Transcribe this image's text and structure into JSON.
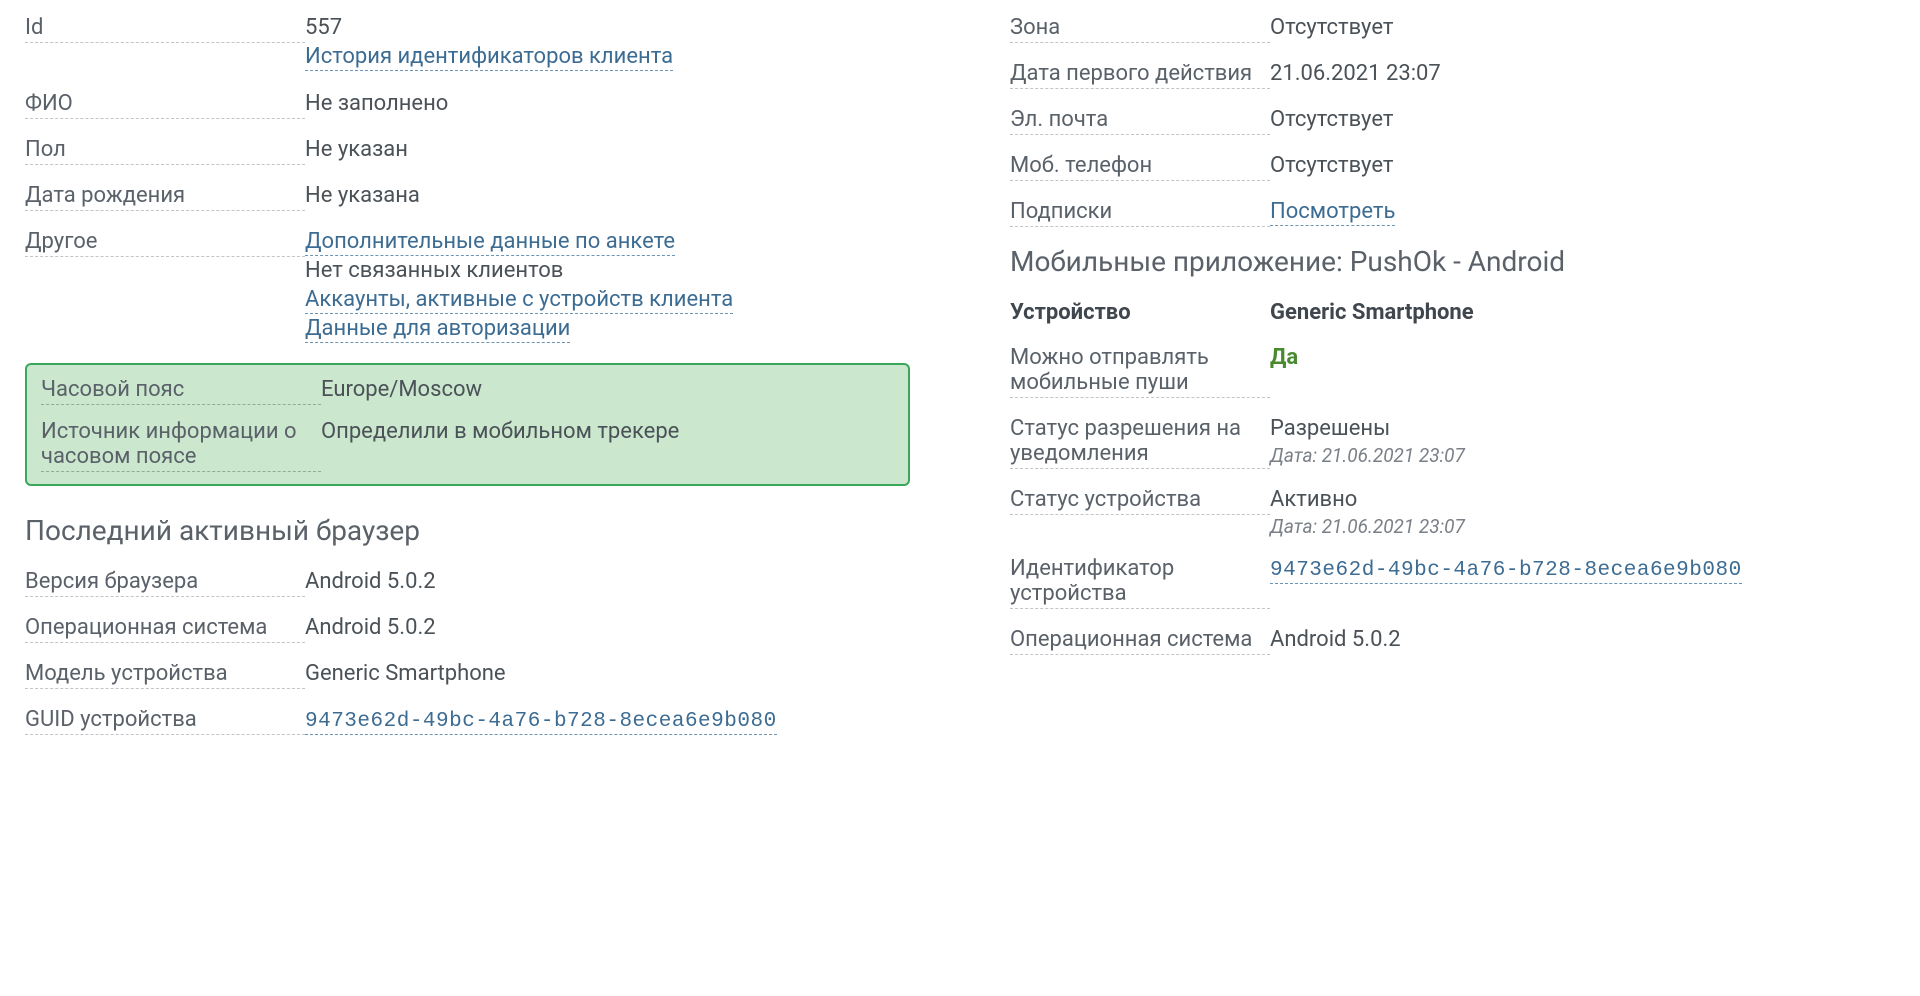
{
  "left": {
    "id_label": "Id",
    "id_value": "557",
    "id_history_link": "История идентификаторов клиента",
    "fio_label": "ФИО",
    "fio_value": "Не заполнено",
    "gender_label": "Пол",
    "gender_value": "Не указан",
    "dob_label": "Дата рождения",
    "dob_value": "Не указана",
    "other_label": "Другое",
    "other_link1": "Дополнительные данные по анкете",
    "other_text": "Нет связанных клиентов",
    "other_link2": "Аккаунты, активные с устройств клиента",
    "other_link3": "Данные для авторизации",
    "tz_label": "Часовой пояс",
    "tz_value": "Europe/Moscow",
    "tz_src_label": "Источник информации о часовом поясе",
    "tz_src_value": "Определили в мобильном трекере",
    "browser_title": "Последний активный браузер",
    "browser_ver_label": "Версия браузера",
    "browser_ver_value": "Android 5.0.2",
    "os_label": "Операционная система",
    "os_value": "Android 5.0.2",
    "model_label": "Модель устройства",
    "model_value": "Generic Smartphone",
    "guid_label": "GUID устройства",
    "guid_value": "9473e62d-49bc-4a76-b728-8ecea6e9b080"
  },
  "right": {
    "zone_label": "Зона",
    "zone_value": "Отсутствует",
    "first_action_label": "Дата первого действия",
    "first_action_value": "21.06.2021 23:07",
    "email_label": "Эл. почта",
    "email_value": "Отсутствует",
    "phone_label": "Моб. телефон",
    "phone_value": "Отсутствует",
    "subs_label": "Подписки",
    "subs_link": "Посмотреть",
    "app_title": "Мобильные приложение: PushOk - Android",
    "device_label": "Устройство",
    "device_value": "Generic Smartphone",
    "push_label": "Можно отправлять мобильные пуши",
    "push_value": "Да",
    "perm_label": "Статус разрешения на уведомления",
    "perm_value": "Разрешены",
    "perm_date": "Дата: 21.06.2021 23:07",
    "status_label": "Статус устройства",
    "status_value": "Активно",
    "status_date": "Дата: 21.06.2021 23:07",
    "devid_label": "Идентификатор устройства",
    "devid_value": "9473e62d-49bc-4a76-b728-8ecea6e9b080",
    "appos_label": "Операционная система",
    "appos_value": "Android 5.0.2"
  }
}
